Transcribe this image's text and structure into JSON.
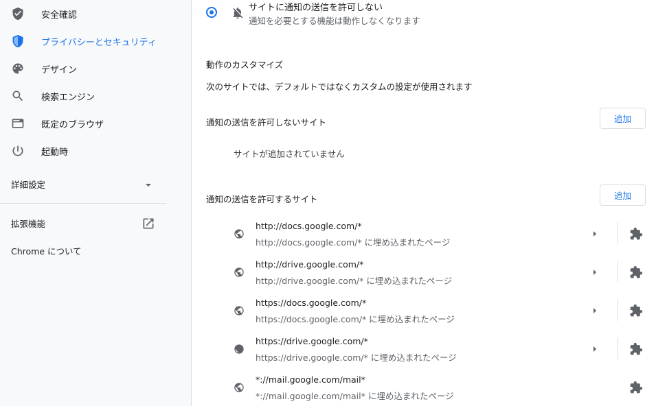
{
  "sidebar": {
    "items": [
      {
        "label": "安全確認",
        "icon": "shield-check-icon"
      },
      {
        "label": "プライバシーとセキュリティ",
        "icon": "shield-half-icon",
        "active": true
      },
      {
        "label": "デザイン",
        "icon": "palette-icon"
      },
      {
        "label": "検索エンジン",
        "icon": "search-icon"
      },
      {
        "label": "既定のブラウザ",
        "icon": "browser-window-icon"
      },
      {
        "label": "起動時",
        "icon": "power-icon"
      }
    ],
    "advanced_label": "詳細設定",
    "extensions_label": "拡張機能",
    "about_label": "Chrome について"
  },
  "main": {
    "radio_option": {
      "title": "サイトに通知の送信を許可しない",
      "description": "通知を必要とする機能は動作しなくなります"
    },
    "customize_heading": "動作のカスタマイズ",
    "customize_description": "次のサイトでは、デフォルトではなくカスタムの設定が使用されます",
    "block_section": {
      "title": "通知の送信を許可しないサイト",
      "add_label": "追加",
      "empty_text": "サイトが追加されていません"
    },
    "allow_section": {
      "title": "通知の送信を許可するサイト",
      "add_label": "追加",
      "sites": [
        {
          "url": "http://docs.google.com/*",
          "sub": "http://docs.google.com/* に埋め込まれたページ",
          "has_arrow": true
        },
        {
          "url": "http://drive.google.com/*",
          "sub": "http://drive.google.com/* に埋め込まれたページ",
          "has_arrow": true
        },
        {
          "url": "https://docs.google.com/*",
          "sub": "https://docs.google.com/* に埋め込まれたページ",
          "has_arrow": true
        },
        {
          "url": "https://drive.google.com/*",
          "sub": "https://drive.google.com/* に埋め込まれたページ",
          "has_arrow": true
        },
        {
          "url": "*://mail.google.com/mail*",
          "sub": "*://mail.google.com/mail* に埋め込まれたページ",
          "has_arrow": false
        }
      ]
    }
  },
  "colors": {
    "accent": "#1a73e8",
    "icon": "#5f6368",
    "text": "#202124",
    "secondary": "#5f6368"
  }
}
